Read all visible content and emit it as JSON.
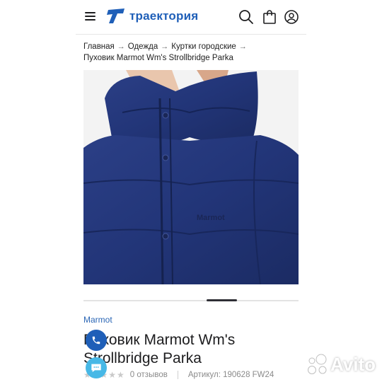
{
  "header": {
    "logo_text": "траектория",
    "menu_icon": "hamburger-icon",
    "search_icon": "search-icon",
    "cart_icon": "shopping-bag-icon",
    "profile_icon": "user-icon",
    "brand_color": "#1f5fb8"
  },
  "breadcrumb": {
    "items": [
      "Главная",
      "Одежда",
      "Куртки городские",
      "Пуховик Marmot Wm's Strollbridge Parka"
    ],
    "separator_icon": "arrow-right-icon"
  },
  "gallery": {
    "image_alt": "Пуховик Marmot Wm's Strollbridge Parka",
    "jacket_logo": "Marmot",
    "active_slide_indicator": "slide-indicator"
  },
  "product": {
    "brand": "Marmot",
    "title": "Пуховик Marmot Wm's Strollbridge Parka",
    "rating_stars": "★★★★★",
    "reviews": "0 отзывов",
    "article": "Артикул: 190628 FW24"
  },
  "floating": {
    "call_icon": "phone-icon",
    "chat_icon": "chat-icon",
    "call_color": "#1f5fb8",
    "chat_color": "#47b8e6"
  },
  "watermark": {
    "text": "Avito"
  }
}
